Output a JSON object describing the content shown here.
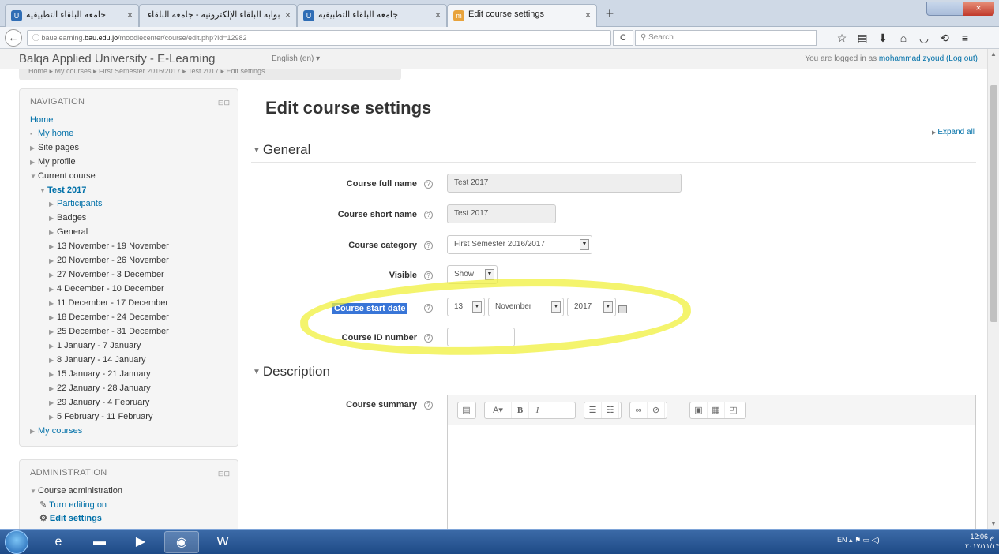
{
  "browser": {
    "tabs": [
      {
        "label": "جامعة البلقاء التطبيقية",
        "active": false
      },
      {
        "label": "بوابة البلقاء الإلكترونية - جامعة البلقاء",
        "active": false
      },
      {
        "label": "جامعة البلقاء التطبيقية",
        "active": false
      },
      {
        "label": "Edit course settings",
        "active": true
      }
    ],
    "url_prefix": "bauelearning.",
    "url_domain": "bau.edu.jo",
    "url_path": "/moodlecenter/course/edit.php?id=12982",
    "search_placeholder": "Search",
    "reload": "C"
  },
  "header": {
    "site_name": "Balqa Applied University - E-Learning",
    "language": "English (en) ▾",
    "login_prefix": "You are logged in as ",
    "login_user": "mohammad zyoud",
    "logout": "(Log out)",
    "breadcrumb": "Home  ▸  My courses  ▸  First Semester 2016/2017  ▸  Test 2017  ▸  Edit settings"
  },
  "navigation": {
    "title": "NAVIGATION",
    "home": "Home",
    "my_home": "My home",
    "site_pages": "Site pages",
    "my_profile": "My profile",
    "current_course": "Current course",
    "course": "Test 2017",
    "participants": "Participants",
    "badges": "Badges",
    "general": "General",
    "weeks": [
      "13 November - 19 November",
      "20 November - 26 November",
      "27 November - 3 December",
      "4 December - 10 December",
      "11 December - 17 December",
      "18 December - 24 December",
      "25 December - 31 December",
      "1 January - 7 January",
      "8 January - 14 January",
      "15 January - 21 January",
      "22 January - 28 January",
      "29 January - 4 February",
      "5 February - 11 February"
    ],
    "my_courses": "My courses"
  },
  "administration": {
    "title": "ADMINISTRATION",
    "course_admin": "Course administration",
    "turn_editing": "Turn editing on",
    "edit_settings": "Edit settings"
  },
  "main": {
    "title": "Edit course settings",
    "expand_all": "Expand all",
    "general_section": "General",
    "description_section": "Description",
    "fields": {
      "full_name_label": "Course full name",
      "full_name_value": "Test 2017",
      "short_name_label": "Course short name",
      "short_name_value": "Test 2017",
      "category_label": "Course category",
      "category_value": "First Semester 2016/2017",
      "visible_label": "Visible",
      "visible_value": "Show",
      "start_date_label": "Course start date",
      "start_day": "13",
      "start_month": "November",
      "start_year": "2017",
      "id_number_label": "Course ID number",
      "summary_label": "Course summary"
    }
  },
  "taskbar": {
    "lang": "EN",
    "time": "12:06 م",
    "date": "٢٠١٧/١١/١٣"
  },
  "colors": {
    "link": "#0070a8",
    "highlight": "#f0f03c",
    "selection": "#3875d7"
  }
}
